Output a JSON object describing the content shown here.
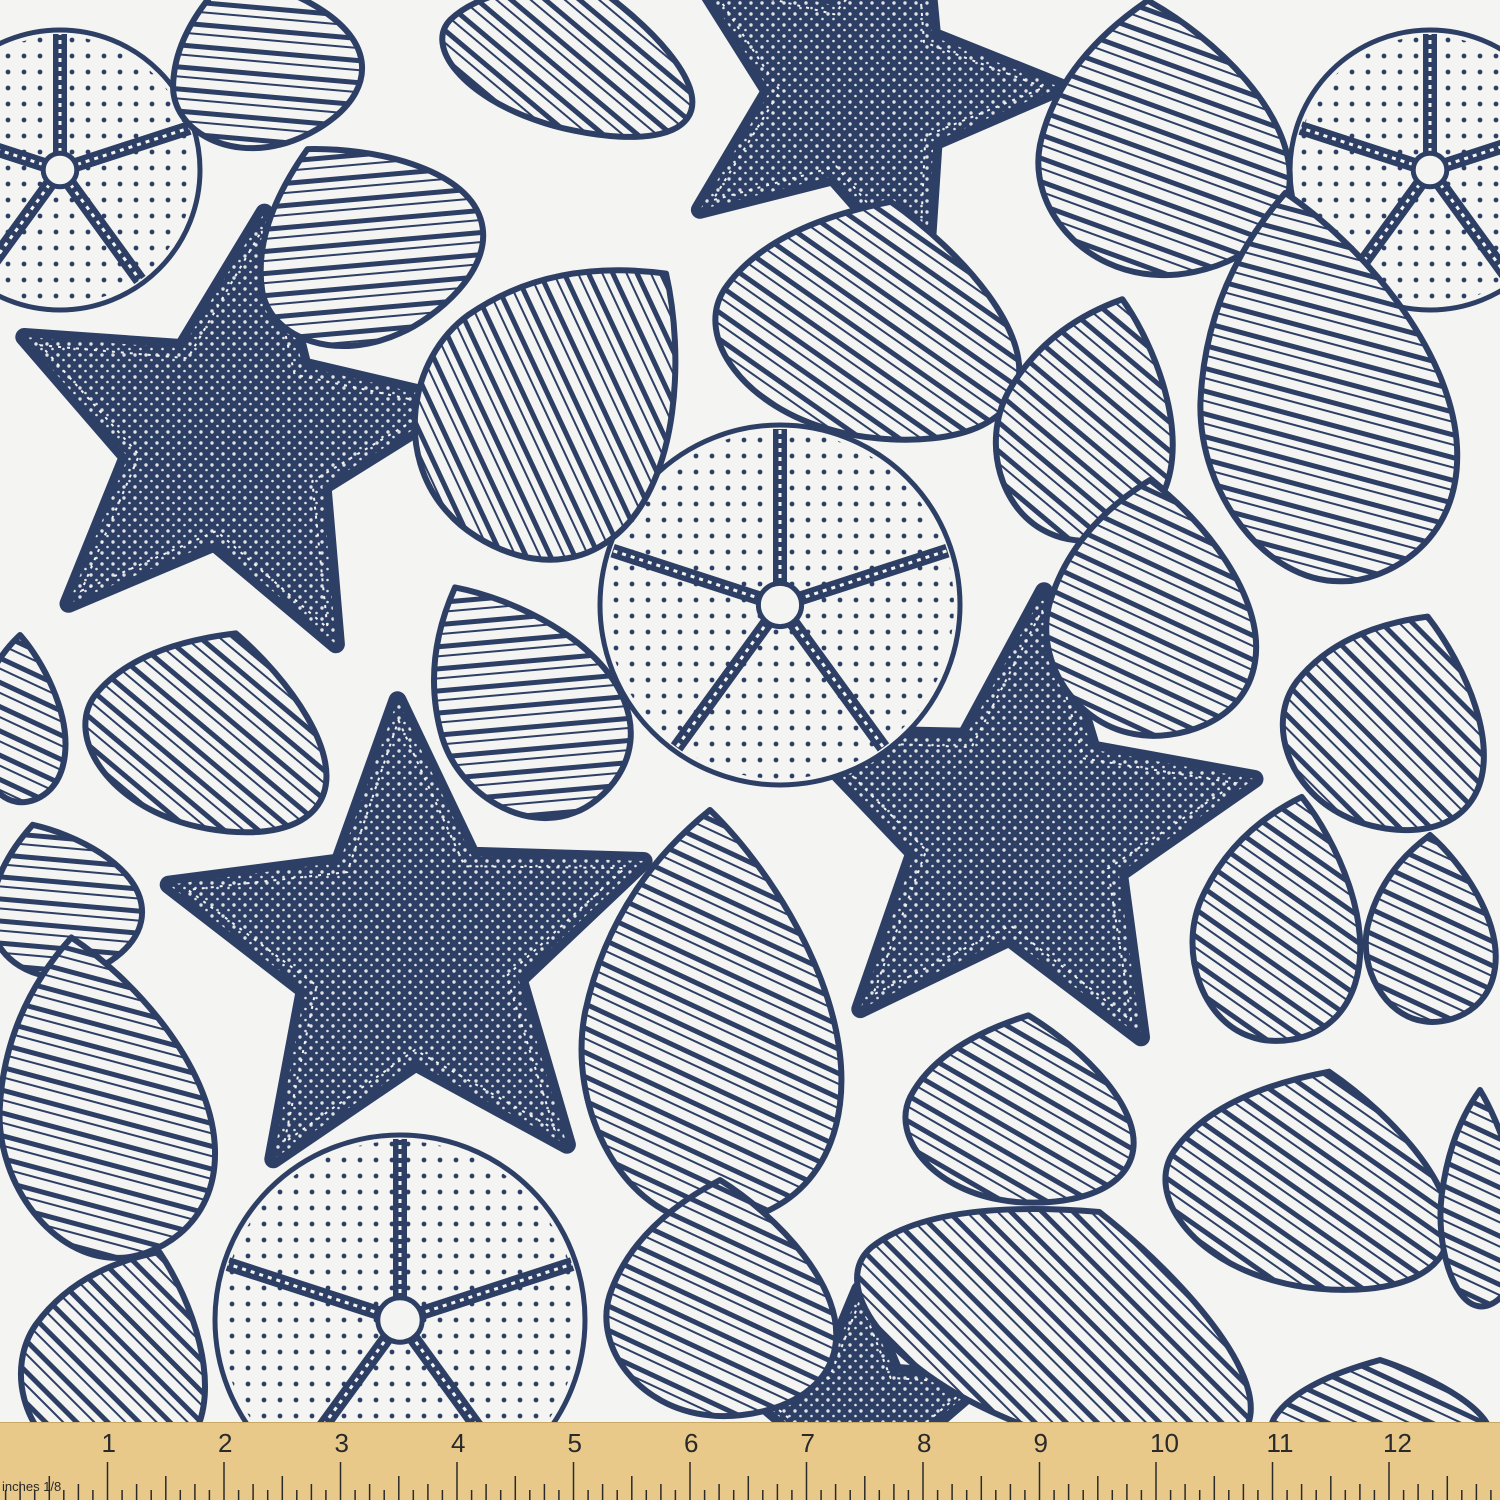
{
  "fabric": {
    "ink_color": "#2e3f66",
    "background_color": "#f4f4f2",
    "motifs": [
      "starfish",
      "sea-urchin",
      "spiral-seashell",
      "conch-shell"
    ]
  },
  "ruler": {
    "color": "#e8c98a",
    "tick_color": "#2a2a2a",
    "unit_label": "inches 1/8",
    "numbers": [
      "1",
      "2",
      "3",
      "4",
      "5",
      "6",
      "7",
      "8",
      "9",
      "10",
      "11",
      "12",
      "1"
    ]
  }
}
